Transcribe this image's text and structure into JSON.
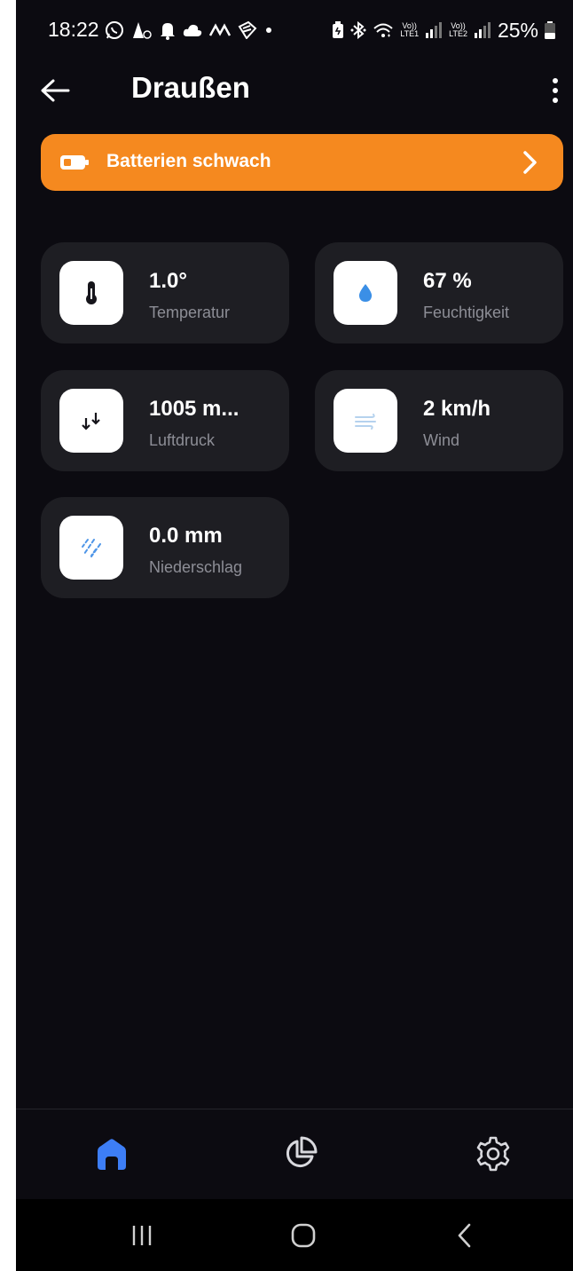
{
  "status_bar": {
    "time": "18:22",
    "battery_percent": "25%",
    "network_1": "LTE1",
    "network_2": "LTE2",
    "volte": "Vo))",
    "notification_icons": [
      "whatsapp-icon",
      "silent-icon",
      "notification-bell-icon",
      "cloud-icon",
      "wave-icon",
      "app-icon",
      "dot-icon"
    ],
    "system_icons": [
      "battery-saver-icon",
      "bluetooth-icon",
      "wifi-icon",
      "signal-icon"
    ]
  },
  "header": {
    "title": "Draußen",
    "back_icon": "arrow-left-icon",
    "menu_icon": "more-vertical-icon"
  },
  "alert": {
    "label": "Batterien schwach",
    "icon": "battery-low-icon",
    "color": "#f5891f"
  },
  "tiles": [
    {
      "value": "1.0°",
      "label": "Temperatur",
      "icon": "thermometer-icon"
    },
    {
      "value": "67 %",
      "label": "Feuchtigkeit",
      "icon": "water-drop-icon"
    },
    {
      "value": "1005 m...",
      "label": "Luftdruck",
      "icon": "pressure-arrows-icon"
    },
    {
      "value": "2 km/h",
      "label": "Wind",
      "icon": "wind-icon"
    },
    {
      "value": "0.0 mm",
      "label": "Niederschlag",
      "icon": "rain-icon"
    }
  ],
  "bottom_nav": {
    "items": [
      {
        "name": "home",
        "icon": "home-icon",
        "active": true
      },
      {
        "name": "statistics",
        "icon": "pie-chart-icon",
        "active": false
      },
      {
        "name": "settings",
        "icon": "gear-icon",
        "active": false
      }
    ],
    "accent_color": "#3d7ef6"
  },
  "system_nav": [
    "recent-apps-icon",
    "home-circle-icon",
    "back-chevron-icon"
  ]
}
